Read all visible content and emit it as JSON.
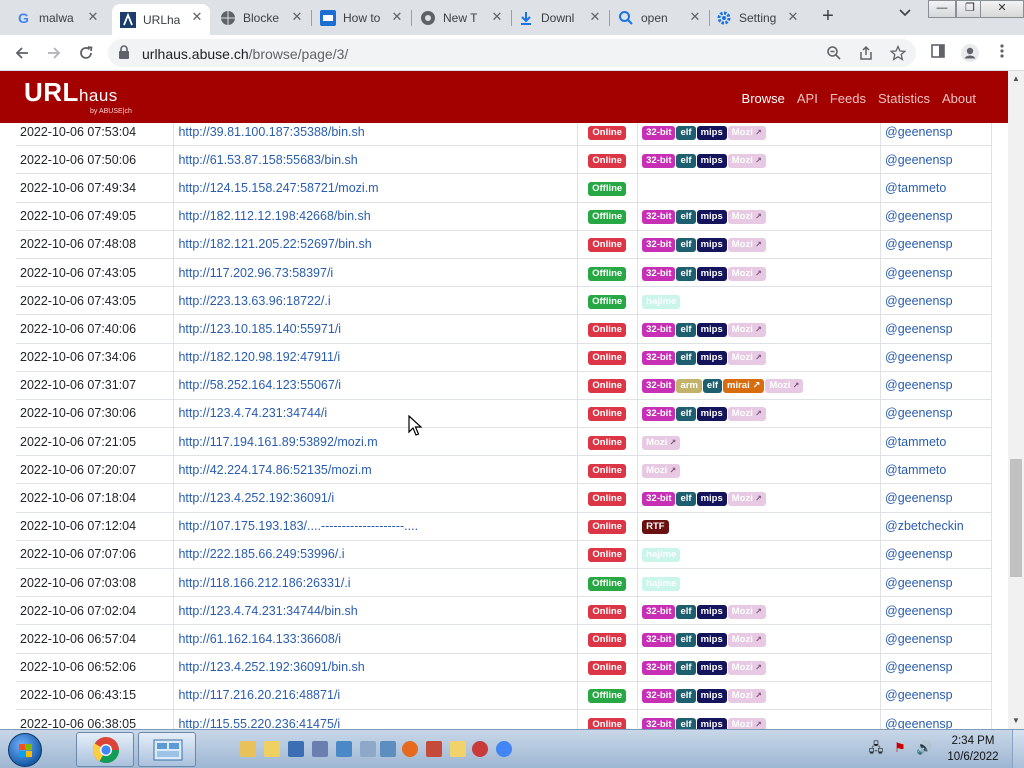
{
  "browser": {
    "tabs": [
      {
        "label": "malwa",
        "icon": "google-icon",
        "active": false
      },
      {
        "label": "URLha",
        "icon": "urlhaus-icon",
        "active": true
      },
      {
        "label": "Blocke",
        "icon": "globe-icon",
        "active": false
      },
      {
        "label": "How to",
        "icon": "video-icon",
        "active": false
      },
      {
        "label": "New T",
        "icon": "chrome-icon",
        "active": false
      },
      {
        "label": "Downl",
        "icon": "download-icon",
        "active": false
      },
      {
        "label": "open",
        "icon": "search-icon",
        "active": false
      },
      {
        "label": "Setting",
        "icon": "gear-icon",
        "active": false
      }
    ],
    "address": {
      "domain": "urlhaus.abuse.ch",
      "path": "/browse/page/3/"
    }
  },
  "site": {
    "logo_main": "URL",
    "logo_sub": "haus",
    "logo_by": "by ABUSE|ch",
    "nav": [
      "Browse",
      "API",
      "Feeds",
      "Statistics",
      "About"
    ],
    "nav_active": "Browse"
  },
  "table": {
    "rows": [
      {
        "date": "2022-10-06 07:53:04",
        "url": "http://39.81.100.187:35388/bin.sh",
        "status": "Online",
        "tags": [
          "32-bit",
          "elf",
          "mips",
          "Mozi"
        ],
        "reporter": "@geenensp"
      },
      {
        "date": "2022-10-06 07:50:06",
        "url": "http://61.53.87.158:55683/bin.sh",
        "status": "Online",
        "tags": [
          "32-bit",
          "elf",
          "mips",
          "Mozi"
        ],
        "reporter": "@geenensp"
      },
      {
        "date": "2022-10-06 07:49:34",
        "url": "http://124.15.158.247:58721/mozi.m",
        "status": "Offline",
        "tags": [],
        "reporter": "@tammeto"
      },
      {
        "date": "2022-10-06 07:49:05",
        "url": "http://182.112.12.198:42668/bin.sh",
        "status": "Offline",
        "tags": [
          "32-bit",
          "elf",
          "mips",
          "Mozi"
        ],
        "reporter": "@geenensp"
      },
      {
        "date": "2022-10-06 07:48:08",
        "url": "http://182.121.205.22:52697/bin.sh",
        "status": "Online",
        "tags": [
          "32-bit",
          "elf",
          "mips",
          "Mozi"
        ],
        "reporter": "@geenensp"
      },
      {
        "date": "2022-10-06 07:43:05",
        "url": "http://117.202.96.73:58397/i",
        "status": "Offline",
        "tags": [
          "32-bit",
          "elf",
          "mips",
          "Mozi"
        ],
        "reporter": "@geenensp"
      },
      {
        "date": "2022-10-06 07:43:05",
        "url": "http://223.13.63.96:18722/.i",
        "status": "Offline",
        "tags": [
          "hajime"
        ],
        "reporter": "@geenensp"
      },
      {
        "date": "2022-10-06 07:40:06",
        "url": "http://123.10.185.140:55971/i",
        "status": "Online",
        "tags": [
          "32-bit",
          "elf",
          "mips",
          "Mozi"
        ],
        "reporter": "@geenensp"
      },
      {
        "date": "2022-10-06 07:34:06",
        "url": "http://182.120.98.192:47911/i",
        "status": "Online",
        "tags": [
          "32-bit",
          "elf",
          "mips",
          "Mozi"
        ],
        "reporter": "@geenensp"
      },
      {
        "date": "2022-10-06 07:31:07",
        "url": "http://58.252.164.123:55067/i",
        "status": "Online",
        "tags": [
          "32-bit",
          "arm",
          "elf",
          "mirai",
          "Mozi"
        ],
        "reporter": "@geenensp"
      },
      {
        "date": "2022-10-06 07:30:06",
        "url": "http://123.4.74.231:34744/i",
        "status": "Online",
        "tags": [
          "32-bit",
          "elf",
          "mips",
          "Mozi"
        ],
        "reporter": "@geenensp"
      },
      {
        "date": "2022-10-06 07:21:05",
        "url": "http://117.194.161.89:53892/mozi.m",
        "status": "Online",
        "tags": [
          "Mozi"
        ],
        "reporter": "@tammeto"
      },
      {
        "date": "2022-10-06 07:20:07",
        "url": "http://42.224.174.86:52135/mozi.m",
        "status": "Online",
        "tags": [
          "Mozi"
        ],
        "reporter": "@tammeto"
      },
      {
        "date": "2022-10-06 07:18:04",
        "url": "http://123.4.252.192:36091/i",
        "status": "Online",
        "tags": [
          "32-bit",
          "elf",
          "mips",
          "Mozi"
        ],
        "reporter": "@geenensp"
      },
      {
        "date": "2022-10-06 07:12:04",
        "url": "http://107.175.193.183/....--------------------....",
        "status": "Online",
        "tags": [
          "RTF"
        ],
        "reporter": "@zbetcheckin"
      },
      {
        "date": "2022-10-06 07:07:06",
        "url": "http://222.185.66.249:53996/.i",
        "status": "Online",
        "tags": [
          "hajime"
        ],
        "reporter": "@geenensp"
      },
      {
        "date": "2022-10-06 07:03:08",
        "url": "http://118.166.212.186:26331/.i",
        "status": "Offline",
        "tags": [
          "hajime"
        ],
        "reporter": "@geenensp"
      },
      {
        "date": "2022-10-06 07:02:04",
        "url": "http://123.4.74.231:34744/bin.sh",
        "status": "Online",
        "tags": [
          "32-bit",
          "elf",
          "mips",
          "Mozi"
        ],
        "reporter": "@geenensp"
      },
      {
        "date": "2022-10-06 06:57:04",
        "url": "http://61.162.164.133:36608/i",
        "status": "Online",
        "tags": [
          "32-bit",
          "elf",
          "mips",
          "Mozi"
        ],
        "reporter": "@geenensp"
      },
      {
        "date": "2022-10-06 06:52:06",
        "url": "http://123.4.252.192:36091/bin.sh",
        "status": "Online",
        "tags": [
          "32-bit",
          "elf",
          "mips",
          "Mozi"
        ],
        "reporter": "@geenensp"
      },
      {
        "date": "2022-10-06 06:43:15",
        "url": "http://117.216.20.216:48871/i",
        "status": "Offline",
        "tags": [
          "32-bit",
          "elf",
          "mips",
          "Mozi"
        ],
        "reporter": "@geenensp"
      },
      {
        "date": "2022-10-06 06:38:05",
        "url": "http://115.55.220.236:41475/i",
        "status": "Online",
        "tags": [
          "32-bit",
          "elf",
          "mips",
          "Mozi"
        ],
        "reporter": "@geenensp"
      }
    ]
  },
  "taskbar": {
    "time": "2:34 PM",
    "date": "10/6/2022"
  },
  "colors": {
    "header_red": "#a30000",
    "online": "#dc3545",
    "offline": "#28a745",
    "link": "#2a5db0"
  }
}
